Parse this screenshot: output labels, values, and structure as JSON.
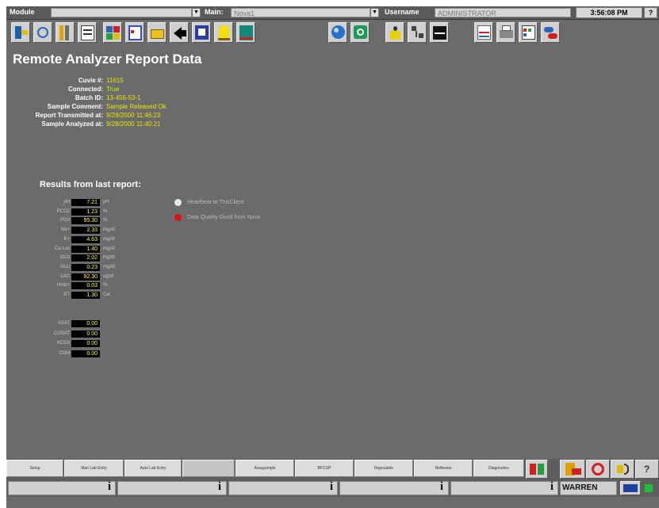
{
  "topbar": {
    "module_label": "Module",
    "module_value": "",
    "main_label": "Main:",
    "main_value": "Nova1",
    "username_label": "Username",
    "username_value": "ADMINISTRATOR",
    "time": "3:56:08 PM",
    "help": "?"
  },
  "toolbar_icons": [
    "exit-icon",
    "refresh-icon",
    "columns-icon",
    "report-icon",
    "grid-icon",
    "calendar-icon",
    "open-folder-icon",
    "back-arrow-icon",
    "screen-icon",
    "alarm-bell-icon",
    "chart-bars-icon",
    "orb-icon",
    "link-icon",
    "warning-person-icon",
    "network-icon",
    "waveform-icon",
    "graph-icon",
    "printer-icon",
    "table-icon",
    "pills-icon"
  ],
  "page": {
    "title": "Remote Analyzer Report Data",
    "info": [
      {
        "label": "Cuvie #:",
        "value": "11615"
      },
      {
        "label": "Connected:",
        "value": "True"
      },
      {
        "label": "Batch ID:",
        "value": "13-456-53-1"
      },
      {
        "label": "Sample Comment:",
        "value": "Sample Released Ok"
      },
      {
        "label": "Report Transmitted at:",
        "value": "9/28/2000 11:46:23"
      },
      {
        "label": "Sample Analyzed at:",
        "value": "9/28/2000 11:40:21"
      }
    ],
    "results_heading": "Results from last report:",
    "results": [
      {
        "label": "pH",
        "value": "7.21",
        "unit": "pH"
      },
      {
        "label": "PCO2",
        "value": "1.23",
        "unit": "%"
      },
      {
        "label": "PO2",
        "value": "95.30",
        "unit": "%"
      },
      {
        "label": "Na+",
        "value": "2.33",
        "unit": "mg/dl"
      },
      {
        "label": "K+",
        "value": "4.63",
        "unit": "mg/dl"
      },
      {
        "label": "Ca Lus",
        "value": "1.40",
        "unit": "mg/dl"
      },
      {
        "label": "GLN",
        "value": "2.02",
        "unit": "mg/dl"
      },
      {
        "label": "GLU",
        "value": "0.23",
        "unit": "mg/dl"
      },
      {
        "label": "LAC",
        "value": "92.30",
        "unit": "ug/dl"
      },
      {
        "label": "Hmb+",
        "value": "0.03",
        "unit": "%"
      },
      {
        "label": "BT",
        "value": "1.30",
        "unit": "Cw"
      }
    ],
    "results2": [
      {
        "label": "ASAT",
        "value": "0.00"
      },
      {
        "label": "COSAT",
        "value": "0.00"
      },
      {
        "label": "HCO3",
        "value": "0.00"
      },
      {
        "label": "OSM",
        "value": "0.00"
      }
    ],
    "status": [
      {
        "text": "Heartbeat to ThisClient",
        "color": "#e8e8e8"
      },
      {
        "text": "Data Quality Good from Nova",
        "color": "#dd1111"
      }
    ]
  },
  "tabs": [
    "Setup",
    "Man Lab Entry",
    "Auto Lab Entry",
    "",
    "Assaysmpls",
    "BFCUP",
    "Reposable",
    "Reflexion",
    "Diagnostics"
  ],
  "bottom_icons": [
    "check-red-icon",
    "red-tools-icon",
    "pencil-flag-icon",
    "no-entry-icon",
    "speaker-icon",
    "help-icon"
  ],
  "statusbar": {
    "info_glyph": "i",
    "user": "WARREN"
  }
}
